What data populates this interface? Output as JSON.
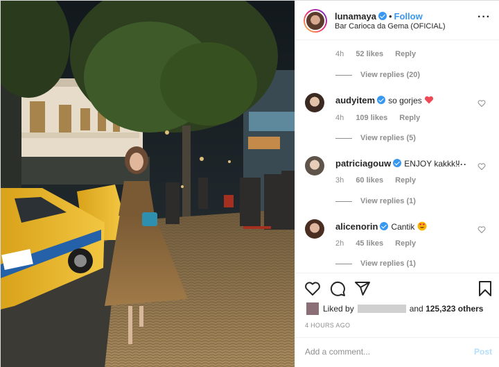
{
  "header": {
    "username": "lunamaya",
    "separator": "•",
    "follow_label": "Follow",
    "location": "Bar Carioca da Gema (OFICIAL)"
  },
  "comments": {
    "first_meta": {
      "time": "4h",
      "likes": "52 likes",
      "reply": "Reply"
    },
    "first_view_replies": "View replies (20)",
    "items": [
      {
        "username": "audyitem",
        "text": "so gorjes",
        "emoji": "heart-emoji",
        "time": "4h",
        "likes": "109 likes",
        "reply": "Reply",
        "view_replies": "View replies (5)"
      },
      {
        "username": "patriciagouw",
        "text": "ENJOY kakkk!!",
        "time": "3h",
        "likes": "60 likes",
        "reply": "Reply",
        "view_replies": "View replies (1)"
      },
      {
        "username": "alicenorin",
        "text": "Cantik",
        "emoji": "heart-eyes-emoji",
        "time": "2h",
        "likes": "45 likes",
        "reply": "Reply",
        "view_replies": "View replies (1)"
      }
    ]
  },
  "likes": {
    "prefix": "Liked by",
    "middle": "and",
    "others": "125,323 others"
  },
  "timestamp": "4 HOURS AGO",
  "add_comment": {
    "placeholder": "Add a comment...",
    "post_label": "Post"
  },
  "colors": {
    "link_blue": "#3897f0",
    "muted": "#8e8e8e",
    "post_disabled": "#b2dffc",
    "heart_red": "#ed4956"
  }
}
